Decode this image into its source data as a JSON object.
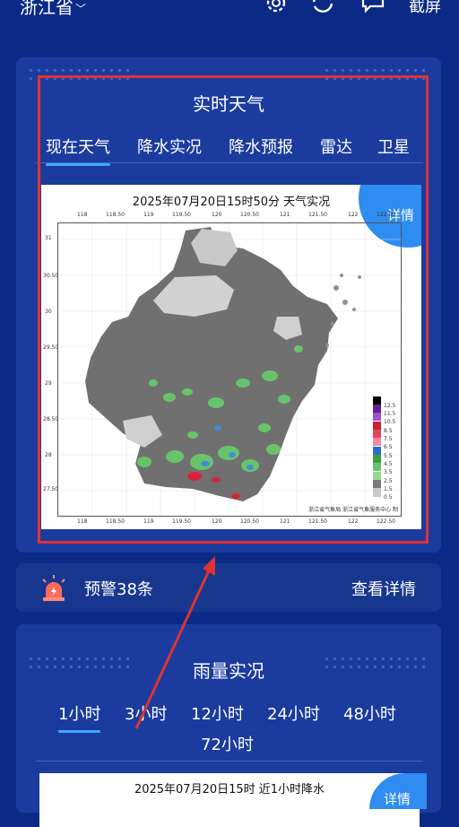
{
  "header": {
    "province": "浙江省",
    "screenshot_label": "截屏"
  },
  "realtime": {
    "title": "实时天气",
    "tabs": [
      {
        "label": "现在天气",
        "active": true
      },
      {
        "label": "降水实况"
      },
      {
        "label": "降水预报"
      },
      {
        "label": "雷达"
      },
      {
        "label": "卫星"
      }
    ],
    "map_title": "2025年07月20日15时50分    天气实况",
    "detail_label": "详情",
    "x_ticks": [
      "118",
      "118.50",
      "119",
      "119.50",
      "120",
      "120.50",
      "121",
      "121.50",
      "122",
      "122.50"
    ],
    "y_ticks": [
      "31",
      "30.50",
      "30",
      "29.50",
      "29",
      "28.50",
      "28",
      "27.50"
    ],
    "legend_labels": [
      "12.5",
      "11.5",
      "10.5",
      "8.5",
      "7.5",
      "6.5",
      "5.5",
      "4.5",
      "3.5",
      "2.5",
      "1.5",
      "0.5"
    ],
    "credit": "浙江省气象局  浙江省气象服务中心 制"
  },
  "warning": {
    "text": "预警38条",
    "link": "查看详情"
  },
  "rain": {
    "title": "雨量实况",
    "tabs": [
      {
        "label": "1小时",
        "active": true
      },
      {
        "label": "3小时"
      },
      {
        "label": "12小时"
      },
      {
        "label": "24小时"
      },
      {
        "label": "48小时"
      },
      {
        "label": "72小时"
      }
    ],
    "panel_title": "2025年07月20日15时  近1小时降水",
    "detail_label": "详情"
  },
  "colors": {
    "background": "#0b2a86",
    "card": "#1b3c9e",
    "accent": "#3ea8ff",
    "highlight_border": "#e03232"
  }
}
